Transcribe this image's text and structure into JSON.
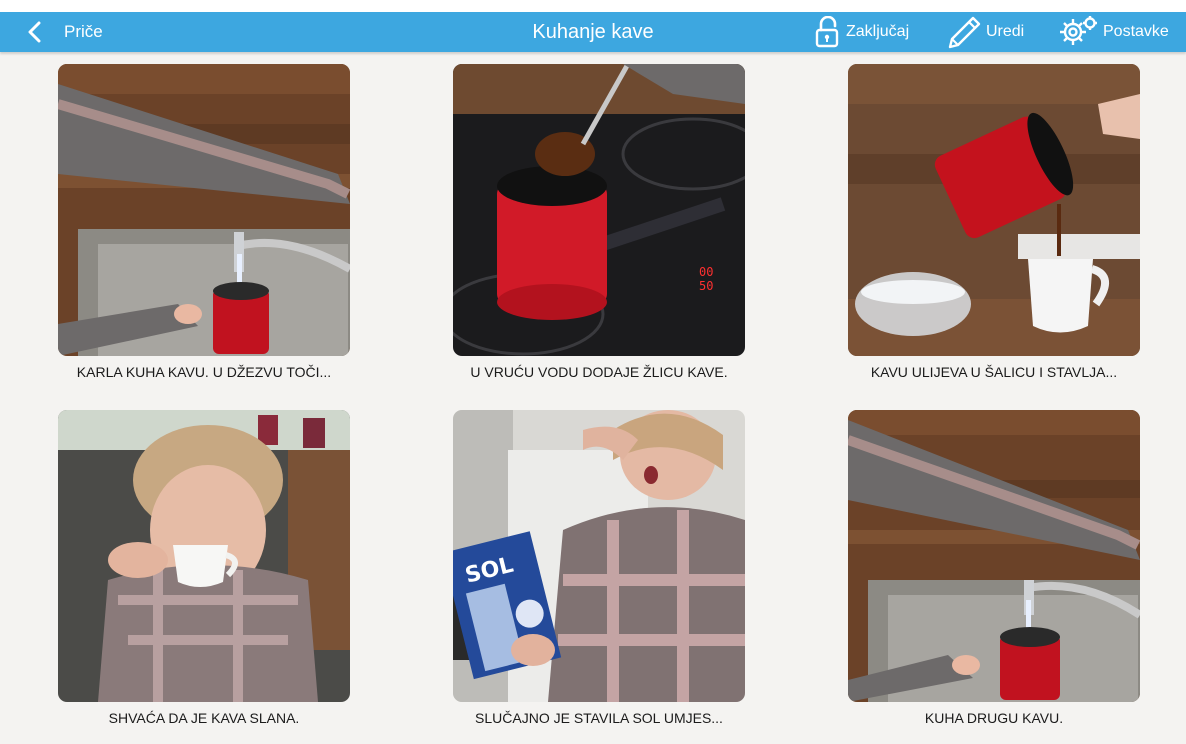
{
  "header": {
    "back_label": "Priče",
    "title": "Kuhanje kave",
    "lock_label": "Zaključaj",
    "edit_label": "Uredi",
    "settings_label": "Postavke"
  },
  "colors": {
    "header_blue": "#3da7e0",
    "background": "#f4f3f1"
  },
  "cards": [
    {
      "caption": "KARLA KUHA KAVU. U DŽEZVU TOČI...",
      "image": "hand-filling-red-pot-at-sink"
    },
    {
      "caption": "U VRUĆU VODU DODAJE ŽLICU KAVE.",
      "image": "spoon-of-coffee-over-red-pot-on-stove"
    },
    {
      "caption": "KAVU ULIJEVA U ŠALICU I STAVLJA...",
      "image": "pouring-coffee-into-white-cup"
    },
    {
      "caption": "SHVAĆA DA JE KAVA SLANA.",
      "image": "woman-grimacing-drinking-coffee"
    },
    {
      "caption": "SLUČAJNO JE STAVILA SOL UMJES...",
      "image": "woman-holding-salt-box-surprised"
    },
    {
      "caption": "KUHA DRUGU KAVU.",
      "image": "hand-filling-red-pot-again"
    }
  ]
}
